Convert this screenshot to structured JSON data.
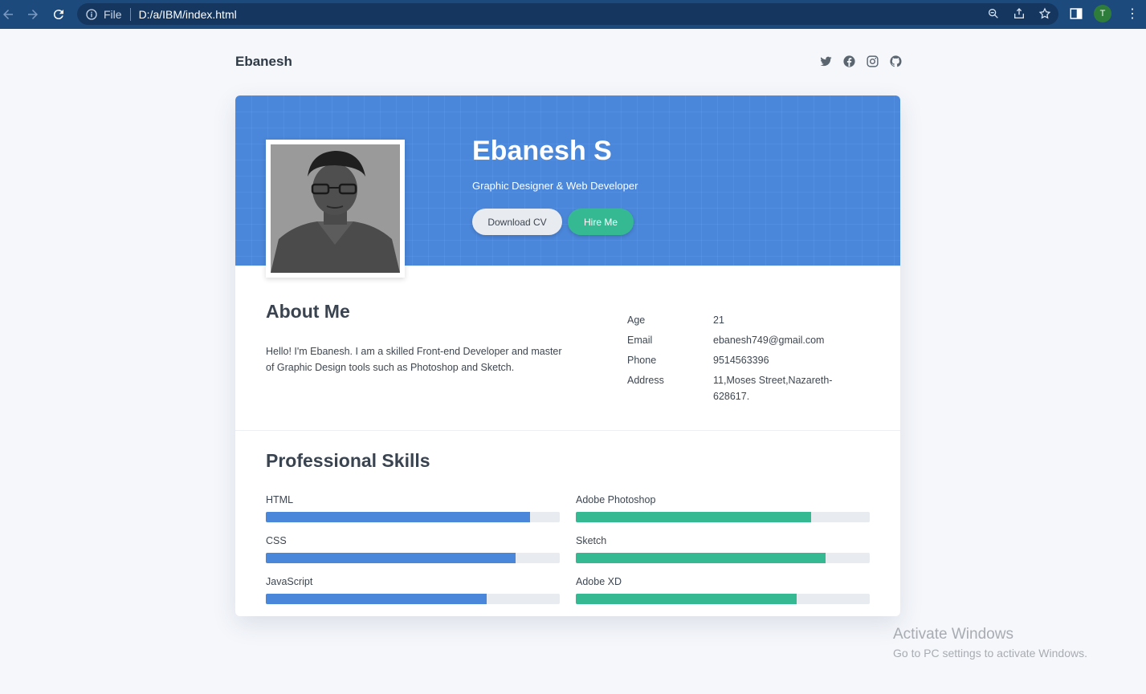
{
  "browser": {
    "file_label": "File",
    "url": "D:/a/IBM/index.html",
    "profile_initial": "T"
  },
  "header": {
    "brand": "Ebanesh",
    "social_icons": [
      "twitter-icon",
      "facebook-icon",
      "instagram-icon",
      "github-icon"
    ]
  },
  "hero": {
    "name": "Ebanesh S",
    "title": "Graphic Designer & Web Developer",
    "download_label": "Download CV",
    "hire_label": "Hire Me"
  },
  "about": {
    "heading": "About Me",
    "text": "Hello! I'm Ebanesh. I am a skilled Front-end Developer and master of Graphic Design tools such as Photoshop and Sketch.",
    "info": [
      {
        "key": "Age",
        "value": "21"
      },
      {
        "key": "Email",
        "value": "ebanesh749@gmail.com"
      },
      {
        "key": "Phone",
        "value": "9514563396"
      },
      {
        "key": "Address",
        "value": "11,Moses Street,Nazareth-628617."
      }
    ]
  },
  "skills": {
    "heading": "Professional Skills",
    "left": [
      {
        "name": "HTML",
        "level": 0.9
      },
      {
        "name": "CSS",
        "level": 0.85
      },
      {
        "name": "JavaScript",
        "level": 0.75
      }
    ],
    "right": [
      {
        "name": "Adobe Photoshop",
        "level": 0.8
      },
      {
        "name": "Sketch",
        "level": 0.85
      },
      {
        "name": "Adobe XD",
        "level": 0.75
      }
    ]
  },
  "colors": {
    "banner": "#4a86d9",
    "dev_bar": "#4a86d9",
    "design_bar": "#35b993"
  },
  "watermark": {
    "line1": "Activate Windows",
    "line2": "Go to PC settings to activate Windows."
  }
}
